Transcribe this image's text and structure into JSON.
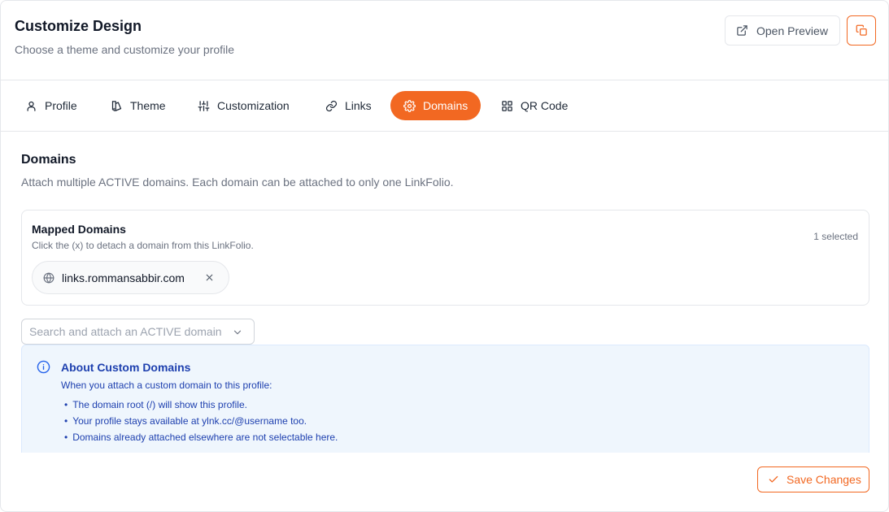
{
  "header": {
    "title": "Customize Design",
    "subtitle": "Choose a theme and customize your profile",
    "open_preview_label": "Open Preview"
  },
  "tabs": [
    {
      "label": "Profile",
      "icon": "user-icon",
      "active": false
    },
    {
      "label": "Theme",
      "icon": "palette-icon",
      "active": false
    },
    {
      "label": "Customization",
      "icon": "sliders-icon",
      "active": false
    },
    {
      "label": "Links",
      "icon": "link-icon",
      "active": false
    },
    {
      "label": "Domains",
      "icon": "gear-icon",
      "active": true
    },
    {
      "label": "QR Code",
      "icon": "qr-code-icon",
      "active": false
    }
  ],
  "domains": {
    "title": "Domains",
    "description": "Attach multiple ACTIVE domains. Each domain can be attached to only one LinkFolio.",
    "mapped": {
      "title": "Mapped Domains",
      "hint": "Click the (x) to detach a domain from this LinkFolio.",
      "selected_count": "1 selected",
      "items": [
        {
          "domain": "links.rommansabbir.com",
          "icon": "globe-icon"
        }
      ]
    },
    "search": {
      "placeholder": "Search and attach an ACTIVE domain"
    },
    "info": {
      "title": "About Custom Domains",
      "intro": "When you attach a custom domain to this profile:",
      "points": [
        "The domain root (/) will show this profile.",
        "Your profile stays available at ylnk.cc/@username too.",
        "Domains already attached elsewhere are not selectable here."
      ]
    }
  },
  "footer": {
    "save_label": "Save Changes"
  },
  "colors": {
    "accent": "#f26822",
    "info_bg": "#eff6fd",
    "info_text": "#1e40af",
    "muted_text": "#6b7280"
  }
}
